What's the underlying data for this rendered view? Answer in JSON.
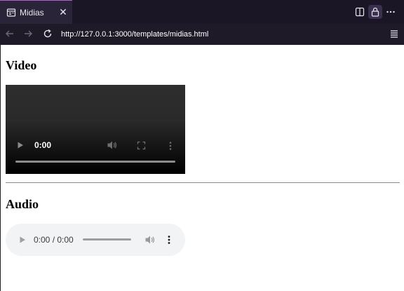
{
  "browser": {
    "tab": {
      "title": "Midias",
      "close_label": "✕"
    },
    "address_bar": {
      "url": "http://127.0.0.1:3000/templates/midias.html"
    }
  },
  "page": {
    "video_section": {
      "heading": "Video",
      "player": {
        "time": "0:00"
      }
    },
    "audio_section": {
      "heading": "Audio",
      "player": {
        "time": "0:00 / 0:00"
      }
    }
  },
  "colors": {
    "browser_chrome": "#1b1626",
    "tab_accent": "#b05fd0",
    "audio_player_bg": "#f1f3f4"
  }
}
